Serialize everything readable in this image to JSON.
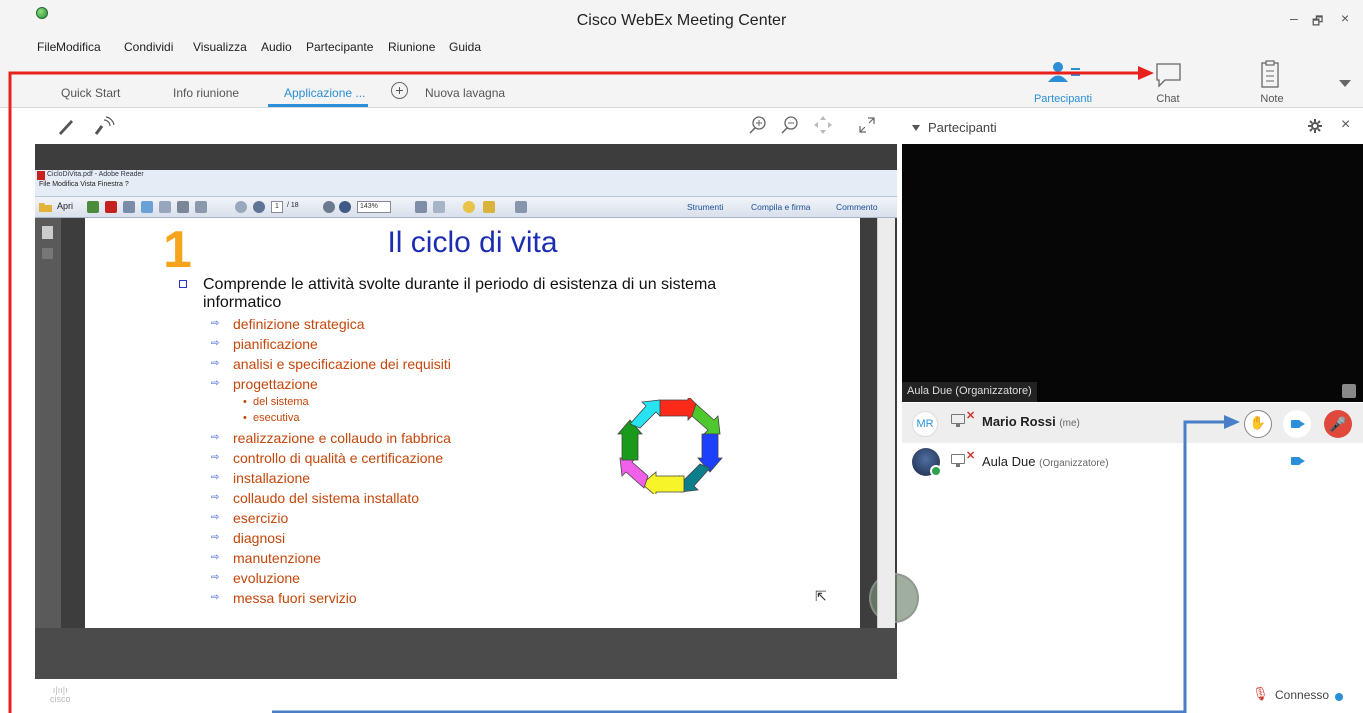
{
  "window": {
    "title": "Cisco WebEx Meeting Center",
    "minimize": "–",
    "restore": "🗗",
    "close": "×"
  },
  "menu": [
    "File",
    "Modifica",
    "Condividi",
    "Visualizza",
    "Audio",
    "Partecipante",
    "Riunione",
    "Guida"
  ],
  "tabs": {
    "quick_start": "Quick Start",
    "info": "Info riunione",
    "app": "Applicazione ...",
    "new_board": "Nuova lavagna"
  },
  "top_tools": {
    "participants": "Partecipanti",
    "chat": "Chat",
    "notes": "Note"
  },
  "panel": {
    "title": "Partecipanti"
  },
  "reader": {
    "title": "CicloDiVita.pdf - Adobe Reader",
    "menu": "File   Modifica   Vista   Finestra   ?",
    "open": "Apri",
    "page": "1",
    "page_total": "/ 18",
    "zoom": "143%",
    "tools": "Strumenti",
    "fill_sign": "Compila e firma",
    "comment": "Commento"
  },
  "slide": {
    "number": "1",
    "title": "Il ciclo di vita",
    "main_bullet": "Comprende le attività svolte durante il periodo di esistenza di un sistema informatico",
    "items": [
      "definizione strategica",
      "pianificazione",
      "analisi e specificazione dei requisiti",
      "progettazione",
      "realizzazione e collaudo in fabbrica",
      "controllo di qualità e certificazione",
      "installazione",
      "collaudo del sistema installato",
      "esercizio",
      "diagnosi",
      "manutenzione",
      "evoluzione",
      "messa fuori servizio"
    ],
    "sub_items": [
      "del sistema",
      "esecutiva"
    ]
  },
  "video": {
    "label": "Aula Due (Organizzatore)"
  },
  "participants": [
    {
      "initials": "MR",
      "name": "Mario Rossi",
      "tag": "(me)"
    },
    {
      "initials": "",
      "name": "Aula Due",
      "tag": "(Organizzatore)"
    }
  ],
  "status": {
    "text": "Connesso"
  },
  "brand": {
    "logo_text": "cisco"
  },
  "colors": {
    "accent": "#2a8fd6",
    "annotation_red": "#e8211d",
    "annotation_blue": "#4a7ec7"
  }
}
